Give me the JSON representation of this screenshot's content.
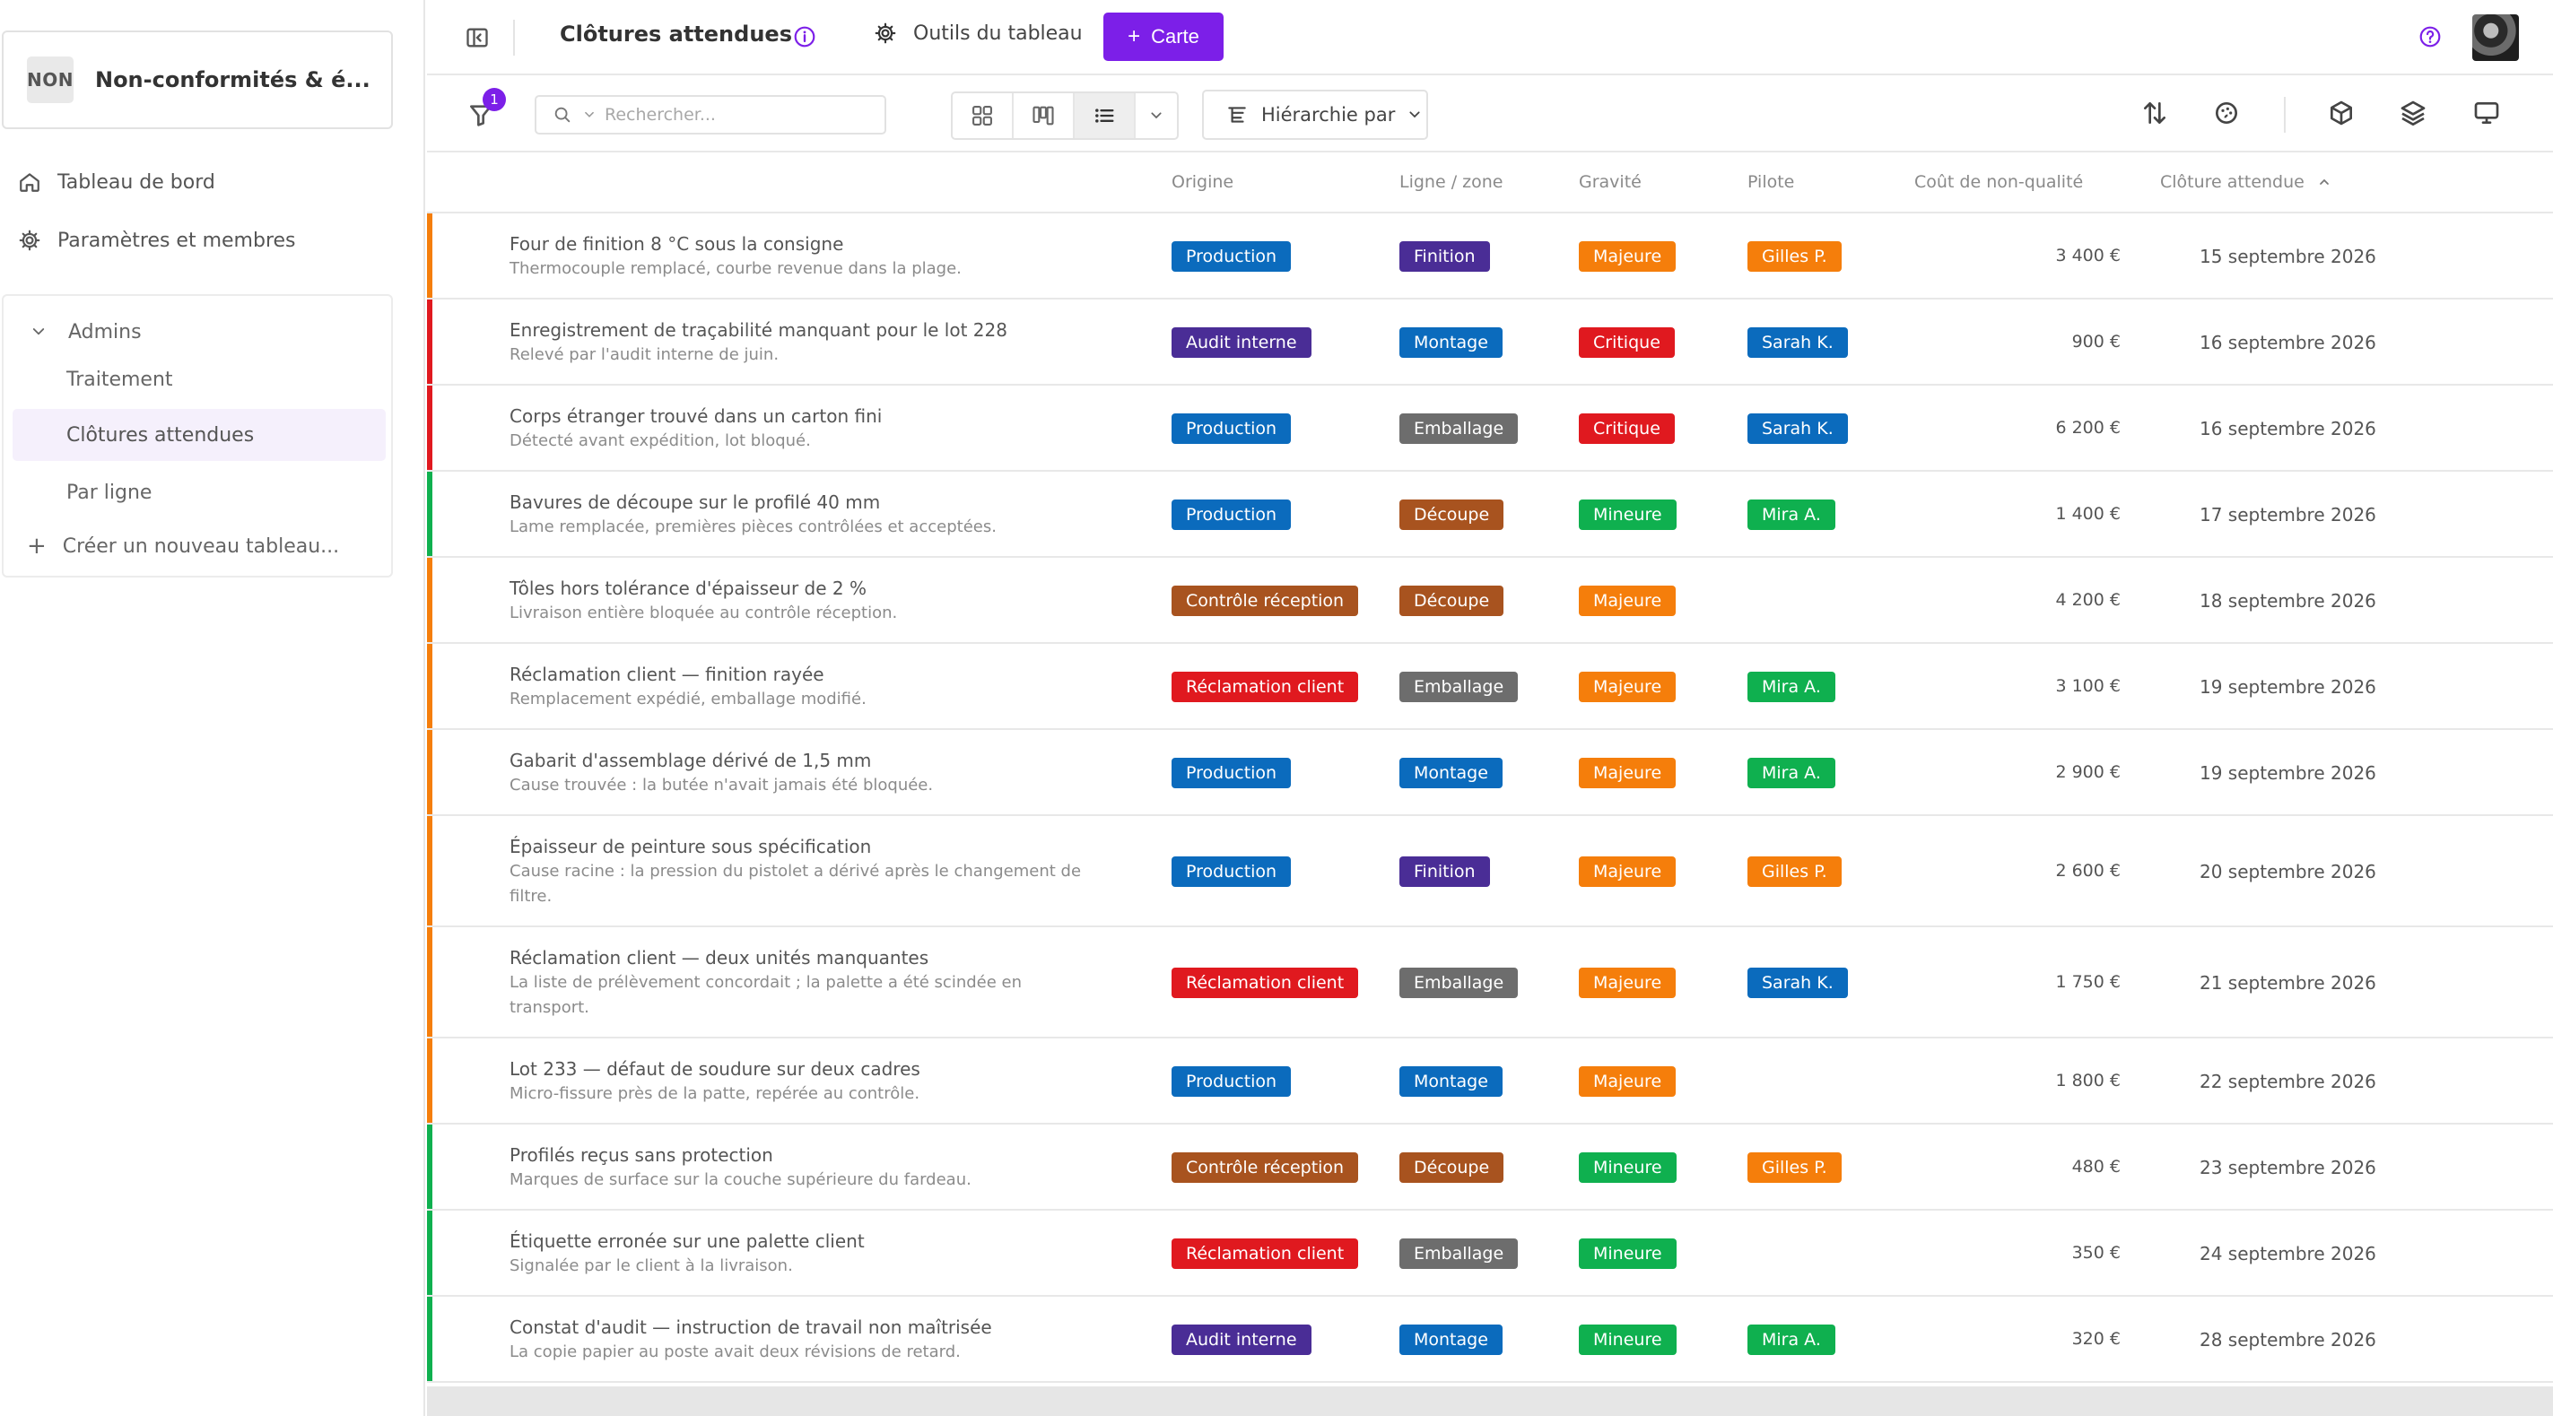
{
  "workspace": {
    "avatar": "NON",
    "name": "Non-conformités & é..."
  },
  "sidebar": {
    "nav": [
      {
        "label": "Tableau de bord",
        "icon": "home-icon"
      },
      {
        "label": "Paramètres et membres",
        "icon": "gear-icon"
      }
    ],
    "group": {
      "label": "Admins",
      "boards": [
        "Traitement",
        "Clôtures attendues",
        "Par ligne"
      ],
      "active_board": "Clôtures attendues",
      "new_board": "Créer un nouveau tableau..."
    }
  },
  "topbar": {
    "title": "Clôtures attendues",
    "tools_label": "Outils du tableau",
    "carte_label": "Carte"
  },
  "toolbar": {
    "filter_count": "1",
    "search_placeholder": "Rechercher...",
    "hierarchy_label": "Hiérarchie par"
  },
  "table": {
    "columns": [
      "Origine",
      "Ligne / zone",
      "Gravité",
      "Pilote",
      "Coût de non-qualité",
      "Clôture attendue"
    ],
    "sorted_column": "Clôture attendue",
    "sort_direction": "ascending",
    "rows": [
      {
        "title": "Four de finition 8 °C sous la consigne",
        "desc": "Thermocouple remplacé, courbe revenue dans la plage.",
        "origine": "Production",
        "ligne": "Finition",
        "gravite": "Majeure",
        "pilote": "Gilles P.",
        "cout": "3 400 €",
        "cloture": "15 septembre 2026"
      },
      {
        "title": "Enregistrement de traçabilité manquant pour le lot 228",
        "desc": "Relevé par l'audit interne de juin.",
        "origine": "Audit interne",
        "ligne": "Montage",
        "gravite": "Critique",
        "pilote": "Sarah K.",
        "cout": "900 €",
        "cloture": "16 septembre 2026"
      },
      {
        "title": "Corps étranger trouvé dans un carton fini",
        "desc": "Détecté avant expédition, lot bloqué.",
        "origine": "Production",
        "ligne": "Emballage",
        "gravite": "Critique",
        "pilote": "Sarah K.",
        "cout": "6 200 €",
        "cloture": "16 septembre 2026"
      },
      {
        "title": "Bavures de découpe sur le profilé 40 mm",
        "desc": "Lame remplacée, premières pièces contrôlées et acceptées.",
        "origine": "Production",
        "ligne": "Découpe",
        "gravite": "Mineure",
        "pilote": "Mira A.",
        "cout": "1 400 €",
        "cloture": "17 septembre 2026"
      },
      {
        "title": "Tôles hors tolérance d'épaisseur de 2 %",
        "desc": "Livraison entière bloquée au contrôle réception.",
        "origine": "Contrôle réception",
        "ligne": "Découpe",
        "gravite": "Majeure",
        "pilote": "",
        "cout": "4 200 €",
        "cloture": "18 septembre 2026"
      },
      {
        "title": "Réclamation client — finition rayée",
        "desc": "Remplacement expédié, emballage modifié.",
        "origine": "Réclamation client",
        "ligne": "Emballage",
        "gravite": "Majeure",
        "pilote": "Mira A.",
        "cout": "3 100 €",
        "cloture": "19 septembre 2026"
      },
      {
        "title": "Gabarit d'assemblage dérivé de 1,5 mm",
        "desc": "Cause trouvée : la butée n'avait jamais été bloquée.",
        "origine": "Production",
        "ligne": "Montage",
        "gravite": "Majeure",
        "pilote": "Mira A.",
        "cout": "2 900 €",
        "cloture": "19 septembre 2026"
      },
      {
        "title": "Épaisseur de peinture sous spécification",
        "desc": "Cause racine : la pression du pistolet a dérivé après le changement de filtre.",
        "origine": "Production",
        "ligne": "Finition",
        "gravite": "Majeure",
        "pilote": "Gilles P.",
        "cout": "2 600 €",
        "cloture": "20 septembre 2026"
      },
      {
        "title": "Réclamation client — deux unités manquantes",
        "desc": "La liste de prélèvement concordait ; la palette a été scindée en transport.",
        "origine": "Réclamation client",
        "ligne": "Emballage",
        "gravite": "Majeure",
        "pilote": "Sarah K.",
        "cout": "1 750 €",
        "cloture": "21 septembre 2026"
      },
      {
        "title": "Lot 233 — défaut de soudure sur deux cadres",
        "desc": "Micro-fissure près de la patte, repérée au contrôle.",
        "origine": "Production",
        "ligne": "Montage",
        "gravite": "Majeure",
        "pilote": "",
        "cout": "1 800 €",
        "cloture": "22 septembre 2026"
      },
      {
        "title": "Profilés reçus sans protection",
        "desc": "Marques de surface sur la couche supérieure du fardeau.",
        "origine": "Contrôle réception",
        "ligne": "Découpe",
        "gravite": "Mineure",
        "pilote": "Gilles P.",
        "cout": "480 €",
        "cloture": "23 septembre 2026"
      },
      {
        "title": "Étiquette erronée sur une palette client",
        "desc": "Signalée par le client à la livraison.",
        "origine": "Réclamation client",
        "ligne": "Emballage",
        "gravite": "Mineure",
        "pilote": "",
        "cout": "350 €",
        "cloture": "24 septembre 2026"
      },
      {
        "title": "Constat d'audit — instruction de travail non maîtrisée",
        "desc": "La copie papier au poste avait deux révisions de retard.",
        "origine": "Audit interne",
        "ligne": "Montage",
        "gravite": "Mineure",
        "pilote": "Mira A.",
        "cout": "320 €",
        "cloture": "28 septembre 2026"
      }
    ]
  },
  "colors": {
    "accent": "#7c1fe8",
    "origine": {
      "Production": "#0b6bbd",
      "Audit interne": "#4a2d96",
      "Contrôle réception": "#a8531f",
      "Réclamation client": "#e0191f"
    },
    "ligne": {
      "Finition": "#4a2d96",
      "Montage": "#0b6bbd",
      "Emballage": "#6d6d6d",
      "Découpe": "#a8531f"
    },
    "gravite": {
      "Majeure": "#f57e0b",
      "Critique": "#e0191f",
      "Mineure": "#0fb04f"
    },
    "pilote": {
      "Gilles P.": "#f57e0b",
      "Sarah K.": "#0b6bbd",
      "Mira A.": "#0fb04f"
    }
  }
}
